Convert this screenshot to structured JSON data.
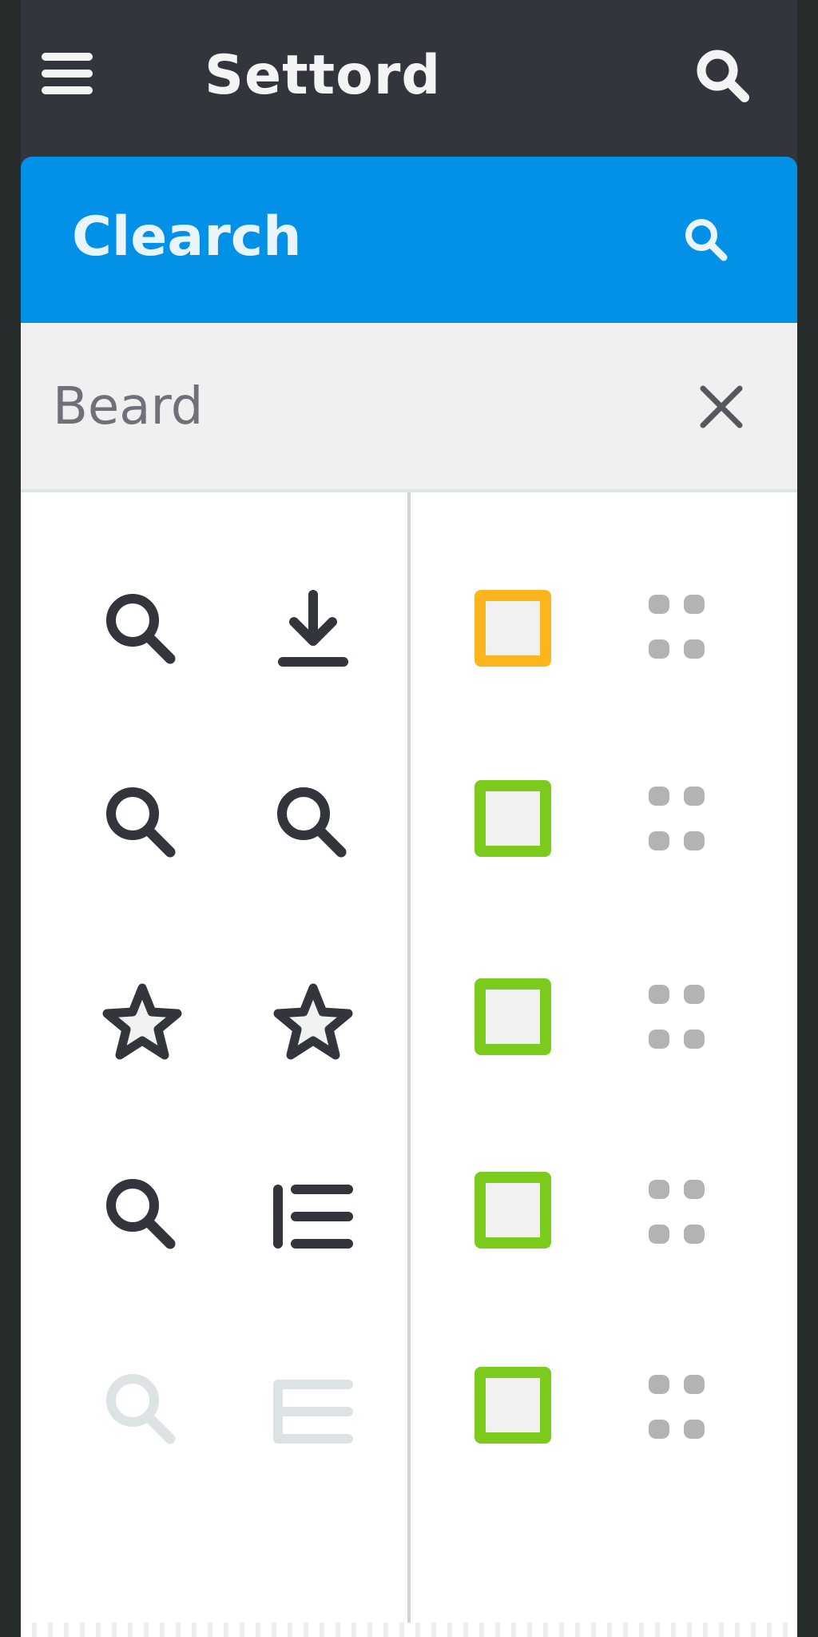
{
  "appbar": {
    "title": "Settord",
    "menu_icon": "hamburger-menu-icon",
    "search_icon": "search-icon"
  },
  "search_header": {
    "title": "Clearch",
    "icon": "search-icon",
    "color": "#0391e8"
  },
  "query": {
    "value": "Beard",
    "clear_icon": "close-icon"
  },
  "left_column": {
    "rows": [
      {
        "icons": [
          "search-icon",
          "download-icon"
        ],
        "disabled": false
      },
      {
        "icons": [
          "search-icon",
          "search-icon"
        ],
        "disabled": false
      },
      {
        "icons": [
          "star-icon",
          "star-icon"
        ],
        "disabled": false
      },
      {
        "icons": [
          "search-icon",
          "list-icon"
        ],
        "disabled": false
      },
      {
        "icons": [
          "search-icon",
          "list-icon"
        ],
        "disabled": true
      }
    ]
  },
  "right_column": {
    "rows": [
      {
        "checkbox_color": "#fdb51e",
        "handle_icon": "drag-handle-icon"
      },
      {
        "checkbox_color": "#7acb1c",
        "handle_icon": "drag-handle-icon"
      },
      {
        "checkbox_color": "#7acb1c",
        "handle_icon": "drag-handle-icon"
      },
      {
        "checkbox_color": "#7acb1c",
        "handle_icon": "drag-handle-icon"
      },
      {
        "checkbox_color": "#7acb1c",
        "handle_icon": "drag-handle-icon"
      }
    ]
  },
  "colors": {
    "appbar_bg": "#32353c",
    "icon_dark": "#32353c",
    "icon_disabled": "#dde3e4",
    "checkbox_orange": "#fdb51e",
    "checkbox_green": "#7acb1c",
    "handle_gray": "#b3b3b3"
  }
}
